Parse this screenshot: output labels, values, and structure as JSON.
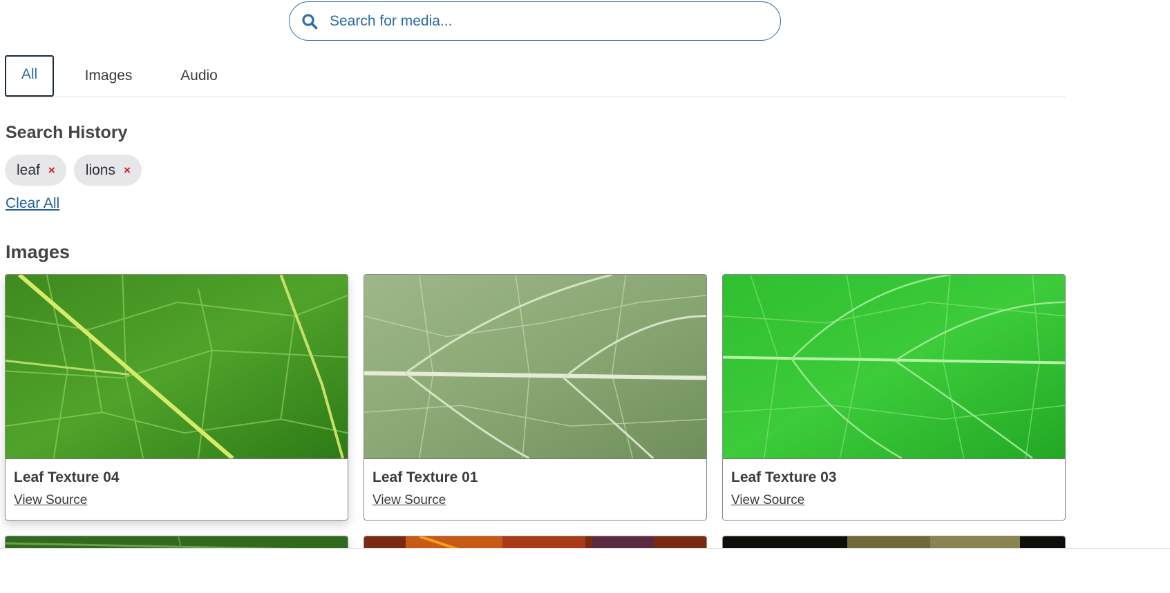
{
  "search": {
    "placeholder": "Search for media...",
    "icon": "search-icon"
  },
  "tabs": [
    {
      "label": "All",
      "active": true
    },
    {
      "label": "Images",
      "active": false
    },
    {
      "label": "Audio",
      "active": false
    }
  ],
  "history": {
    "title": "Search History",
    "chips": [
      {
        "label": "leaf",
        "remove": "×"
      },
      {
        "label": "lions",
        "remove": "×"
      }
    ],
    "clear_label": "Clear All"
  },
  "images": {
    "title": "Images",
    "cards": [
      {
        "title": "Leaf Texture 04",
        "link": "View Source"
      },
      {
        "title": "Leaf Texture 01",
        "link": "View Source"
      },
      {
        "title": "Leaf Texture 03",
        "link": "View Source"
      }
    ]
  },
  "colors": {
    "accent": "#2b6ea8",
    "remove": "#d21a1a",
    "chip_bg": "#e7e7ea"
  }
}
